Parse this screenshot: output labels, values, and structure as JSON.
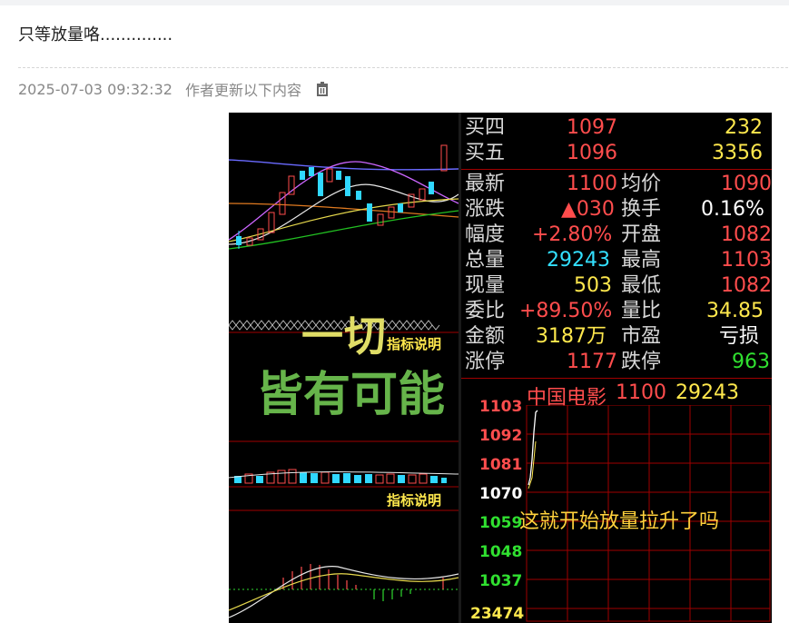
{
  "post": {
    "text": "只等放量咯..............",
    "timestamp": "2025-07-03 09:32:32",
    "update_note": "作者更新以下内容",
    "delete_icon": "trash-icon"
  },
  "screenshot": {
    "overlay_line1": "一切",
    "overlay_line2": "皆有可能",
    "indicator_label_1": "指标说明",
    "indicator_label_2": "指标说明",
    "overlay_question": "这就开始放量拉升了吗",
    "quotes_top": [
      {
        "label": "买四",
        "price": "1097",
        "vol": "232"
      },
      {
        "label": "买五",
        "price": "1096",
        "vol": "3356"
      }
    ],
    "stats": [
      {
        "l1": "最新",
        "v1": "1100",
        "l2": "均价",
        "v2": "1090"
      },
      {
        "l1": "涨跌",
        "v1": "▲030",
        "l2": "换手",
        "v2": "0.16%"
      },
      {
        "l1": "幅度",
        "v1": "+2.80%",
        "l2": "开盘",
        "v2": "1082"
      },
      {
        "l1": "总量",
        "v1": "29243",
        "l2": "最高",
        "v2": "1103"
      },
      {
        "l1": "现量",
        "v1": "503",
        "l2": "最低",
        "v2": "1082"
      },
      {
        "l1": "委比",
        "v1": "+89.50%",
        "l2": "量比",
        "v2": "34.85"
      },
      {
        "l1": "金额",
        "v1": "3187万",
        "l2": "市盈",
        "v2": "亏损"
      },
      {
        "l1": "涨停",
        "v1": "1177",
        "l2": "跌停",
        "v2": "963"
      }
    ],
    "stock_header": {
      "name": "中国电影",
      "price": "1100",
      "volume": "29243"
    },
    "price_axis": [
      "1103",
      "1092",
      "1081",
      "1070",
      "1059",
      "1048",
      "1037"
    ],
    "bottom_volume": "23474",
    "colors": {
      "red": "#ff4d4d",
      "yellow": "#ffe84d",
      "cyan": "#33e0ff",
      "green": "#30e030",
      "grid": "#a00000"
    }
  }
}
